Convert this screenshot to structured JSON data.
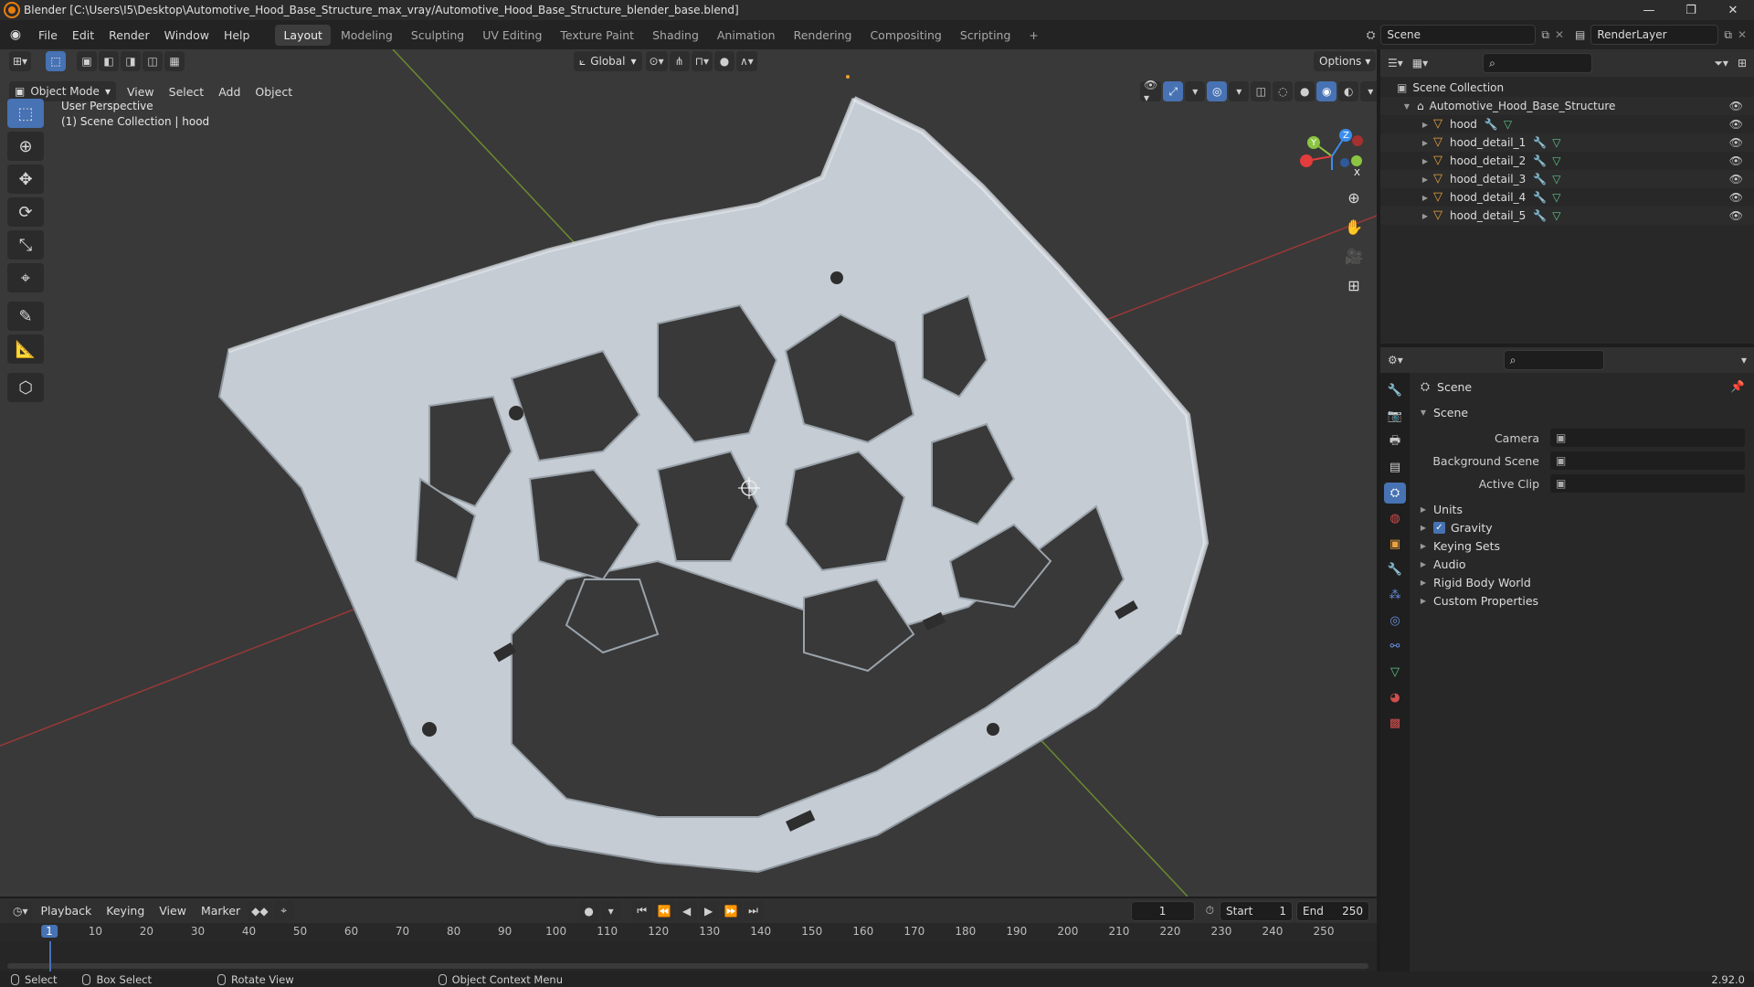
{
  "window": {
    "title": "Blender [C:\\Users\\I5\\Desktop\\Automotive_Hood_Base_Structure_max_vray/Automotive_Hood_Base_Structure_blender_base.blend]",
    "minimize": "—",
    "maximize": "❐",
    "close": "✕"
  },
  "menubar": {
    "items": [
      "File",
      "Edit",
      "Render",
      "Window",
      "Help"
    ],
    "workspaces": [
      "Layout",
      "Modeling",
      "Sculpting",
      "UV Editing",
      "Texture Paint",
      "Shading",
      "Animation",
      "Rendering",
      "Compositing",
      "Scripting"
    ],
    "active_workspace": "Layout",
    "add_workspace": "+",
    "scene_name": "Scene",
    "view_layer": "RenderLayer"
  },
  "viewport": {
    "mode": "Object Mode",
    "menus": [
      "View",
      "Select",
      "Add",
      "Object"
    ],
    "transform_orientation": "Global",
    "options_label": "Options",
    "info_line1": "User Perspective",
    "info_line2": "(1) Scene Collection | hood",
    "gizmo": {
      "x": "X",
      "y": "Y",
      "z": "Z"
    }
  },
  "outliner": {
    "root": "Scene Collection",
    "collection": "Automotive_Hood_Base_Structure",
    "objects": [
      "hood",
      "hood_detail_1",
      "hood_detail_2",
      "hood_detail_3",
      "hood_detail_4",
      "hood_detail_5"
    ]
  },
  "properties": {
    "context": "Scene",
    "panel": "Scene",
    "fields": [
      {
        "label": "Camera",
        "value": ""
      },
      {
        "label": "Background Scene",
        "value": ""
      },
      {
        "label": "Active Clip",
        "value": ""
      }
    ],
    "sections": [
      "Units",
      "Gravity",
      "Keying Sets",
      "Audio",
      "Rigid Body World",
      "Custom Properties"
    ],
    "gravity_checked": true
  },
  "timeline": {
    "menus": [
      "Playback",
      "Keying",
      "View",
      "Marker"
    ],
    "current_frame": "1",
    "start_label": "Start",
    "start": "1",
    "end_label": "End",
    "end": "250",
    "ticks": [
      "1",
      "10",
      "20",
      "30",
      "40",
      "50",
      "60",
      "70",
      "80",
      "90",
      "100",
      "110",
      "120",
      "130",
      "140",
      "150",
      "160",
      "170",
      "180",
      "190",
      "200",
      "210",
      "220",
      "230",
      "240",
      "250"
    ]
  },
  "statusbar": {
    "select": "Select",
    "box_select": "Box Select",
    "rotate_view": "Rotate View",
    "context_menu": "Object Context Menu",
    "version": "2.92.0"
  },
  "colors": {
    "accent": "#4772b3",
    "x_axis": "#e23c3c",
    "y_axis": "#8bc541",
    "z_axis": "#3b8ded",
    "hood_surface": "#c8d0d8"
  }
}
